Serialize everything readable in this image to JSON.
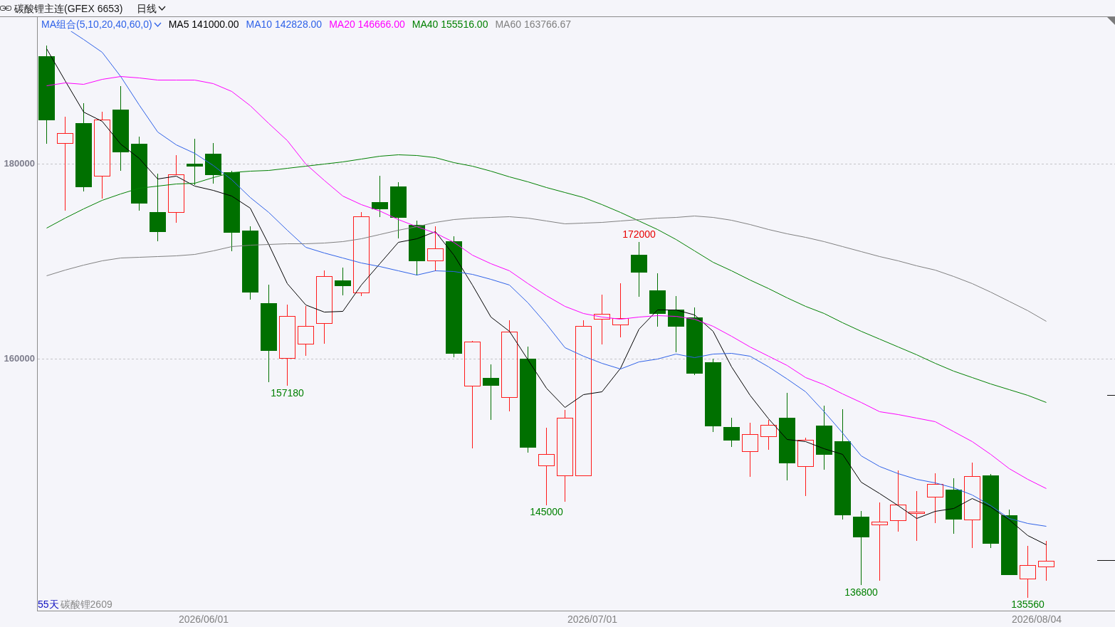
{
  "header": {
    "title": "碳酸锂主连(GFEX 6653)",
    "period": "日线"
  },
  "legend": {
    "preset": "MA组合(5,10,20,40,60,0)",
    "items": [
      {
        "label": "MA5 141000.00",
        "color": "#000000"
      },
      {
        "label": "MA10 142828.00",
        "color": "#2f62e8"
      },
      {
        "label": "MA20 146666.00",
        "color": "#ff00ff"
      },
      {
        "label": "MA40 155516.00",
        "color": "#008000"
      },
      {
        "label": "MA60 163766.67",
        "color": "#808080"
      }
    ]
  },
  "chart": {
    "y_axis_labels": [
      "180000",
      "160000"
    ],
    "x_axis_labels": [
      "2026/06/01",
      "2026/07/01",
      "2026/08/04"
    ],
    "annotations": [
      {
        "text": "157180",
        "kind": "low"
      },
      {
        "text": "145000",
        "kind": "low"
      },
      {
        "text": "172000",
        "kind": "high"
      },
      {
        "text": "136800",
        "kind": "low"
      },
      {
        "text": "135560",
        "kind": "low"
      }
    ],
    "day_count": "55天",
    "contract": "碳酸锂2609"
  }
}
